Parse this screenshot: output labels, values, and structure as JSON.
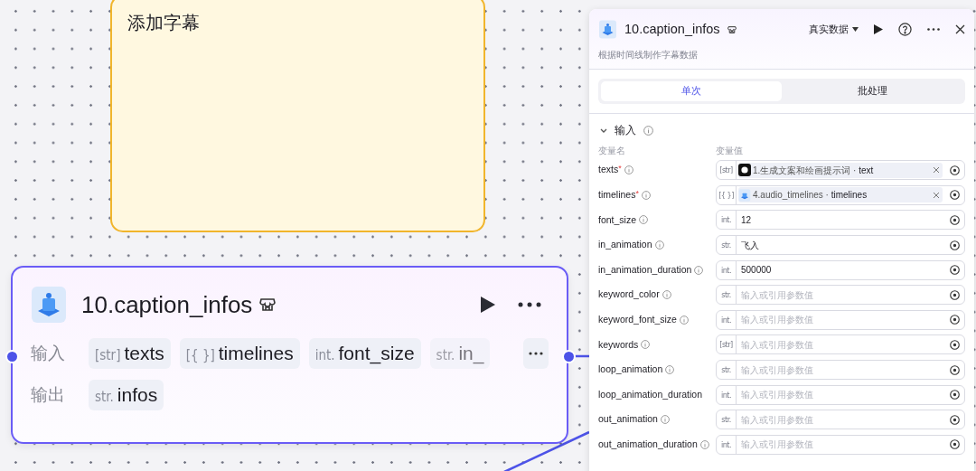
{
  "note": {
    "text": "添加字幕"
  },
  "node": {
    "title": "10.caption_infos",
    "input_label": "输入",
    "output_label": "输出",
    "inputs": [
      {
        "type": "[str]",
        "name": "texts",
        "faded": false
      },
      {
        "type": "[{ }]",
        "name": "timelines",
        "faded": false
      },
      {
        "type": "int.",
        "name": "font_size",
        "faded": false
      },
      {
        "type": "str.",
        "name": "in_",
        "faded": true
      }
    ],
    "outputs": [
      {
        "type": "str.",
        "name": "infos",
        "faded": false
      }
    ]
  },
  "panel": {
    "title": "10.caption_infos",
    "data_mode": "真实数据",
    "description": "根据时间线制作字幕数据",
    "tabs": [
      {
        "label": "单次",
        "selected": true
      },
      {
        "label": "批处理",
        "selected": false
      }
    ],
    "section": {
      "title": "输入",
      "expanded": true
    },
    "columns": [
      "变量名",
      "变量值"
    ],
    "params": [
      {
        "name": "texts",
        "required_mark": "*",
        "info": true,
        "type": "[str]",
        "kind": "reference",
        "value": "1.生成文案和绘画提示词 · **text**"
      },
      {
        "name": "timelines",
        "required_mark": "*",
        "info": true,
        "type": "[{ }]",
        "kind": "reference",
        "value": "4.audio_timelines · **timelines**"
      },
      {
        "name": "font_size",
        "info": true,
        "type": "int.",
        "kind": "value",
        "value": "12"
      },
      {
        "name": "in_animation",
        "info": true,
        "type": "str.",
        "kind": "value",
        "value": "飞入"
      },
      {
        "name": "in_animation_duration",
        "info": true,
        "type": "int.",
        "kind": "value",
        "value": "500000"
      },
      {
        "name": "keyword_color",
        "info": true,
        "type": "str.",
        "kind": "empty",
        "placeholder": "输入或引用参数值"
      },
      {
        "name": "keyword_font_size",
        "info": true,
        "type": "int.",
        "kind": "empty",
        "placeholder": "输入或引用参数值"
      },
      {
        "name": "keywords",
        "info": true,
        "type": "[str]",
        "kind": "empty",
        "placeholder": "输入或引用参数值"
      },
      {
        "name": "loop_animation",
        "info": true,
        "type": "str.",
        "kind": "empty",
        "placeholder": "输入或引用参数值"
      },
      {
        "name": "loop_animation_duration",
        "info": false,
        "type": "int.",
        "kind": "empty",
        "placeholder": "输入或引用参数值"
      },
      {
        "name": "out_animation",
        "info": true,
        "type": "str.",
        "kind": "empty",
        "placeholder": "输入或引用参数值"
      },
      {
        "name": "out_animation_duration",
        "info": true,
        "type": "int.",
        "kind": "empty",
        "placeholder": "输入或引用参数值"
      }
    ]
  }
}
